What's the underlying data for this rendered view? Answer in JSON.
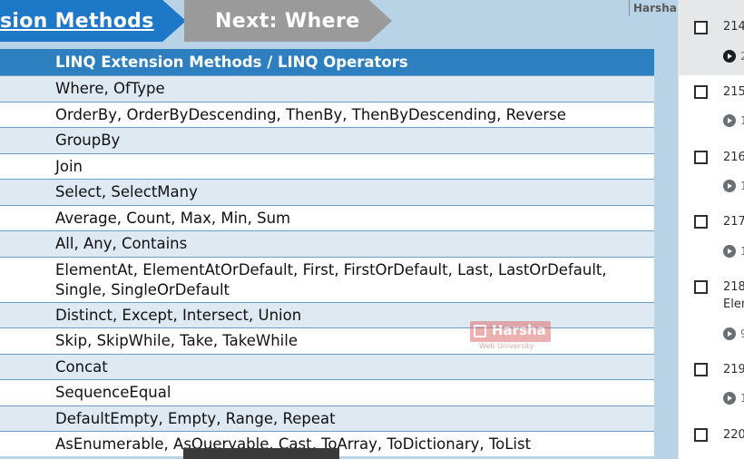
{
  "slide": {
    "current_section": "sion Methods",
    "next_section": "Next: Where",
    "brand_label": "Harsha",
    "table_header": "LINQ Extension Methods / LINQ Operators",
    "rows": [
      "Where, OfType",
      "OrderBy, OrderByDescending, ThenBy, ThenByDescending, Reverse",
      "GroupBy",
      "Join",
      "Select, SelectMany",
      "Average, Count, Max, Min, Sum",
      "All, Any, Contains",
      "ElementAt, ElementAtOrDefault, First, FirstOrDefault, Last, LastOrDefault, Single, SingleOrDefault",
      "Distinct, Except, Intersect, Union",
      "Skip, SkipWhile, Take, TakeWhile",
      "Concat",
      "SequenceEqual",
      "DefaultEmpty, Empty, Range, Repeat",
      "AsEnumerable, AsQueryable, Cast, ToArray, ToDictionary, ToList"
    ],
    "watermark": {
      "name": "Harsha",
      "subtitle": "Web University"
    }
  },
  "sidebar": {
    "lectures": [
      {
        "number": "214.",
        "extra": "",
        "duration": "2",
        "active": true
      },
      {
        "number": "215.",
        "extra": "",
        "duration": "1",
        "active": false
      },
      {
        "number": "216.",
        "extra": "",
        "duration": "1",
        "active": false
      },
      {
        "number": "217.",
        "extra": "",
        "duration": "1",
        "active": false
      },
      {
        "number": "218.",
        "extra": "Elen",
        "duration": "9",
        "active": false
      },
      {
        "number": "219.",
        "extra": "",
        "duration": "1",
        "active": false
      },
      {
        "number": "220",
        "extra": "",
        "duration": "",
        "active": false
      }
    ]
  },
  "colors": {
    "current_section": "#1e78c8",
    "next_section": "#9a9a9a",
    "table_header": "#2e7fc0",
    "row_alt": "#dfe9f2",
    "slide_bg": "#b8d2e6"
  }
}
